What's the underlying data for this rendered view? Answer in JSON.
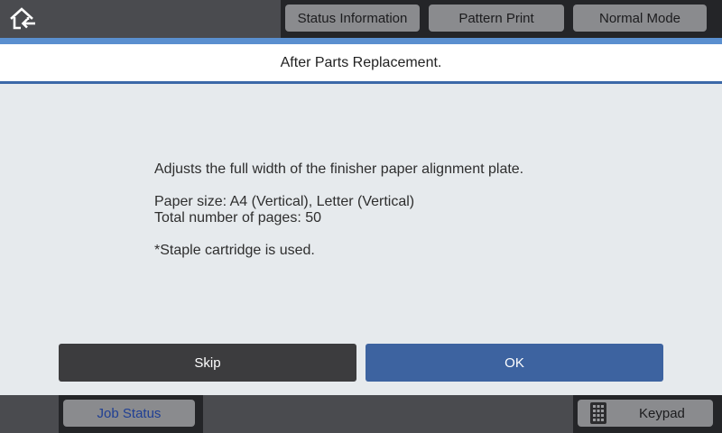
{
  "header": {
    "home_icon": "home-back-icon",
    "buttons": {
      "status_information": "Status Information",
      "pattern_print": "Pattern Print",
      "normal_mode": "Normal Mode"
    }
  },
  "title": "After Parts Replacement.",
  "message": {
    "line1": "Adjusts the full width of the finisher paper alignment plate.",
    "line2": "Paper size: A4 (Vertical), Letter (Vertical)",
    "line3": "Total number of pages: 50",
    "line4": "*Staple cartridge is used."
  },
  "actions": {
    "skip": "Skip",
    "ok": "OK"
  },
  "footer": {
    "job_status": "Job Status",
    "keypad": "Keypad",
    "keypad_icon": "keypad-icon"
  },
  "colors": {
    "accent": "#5a8fcf",
    "ok_button": "#3d63a0",
    "skip_button": "#3c3c3e",
    "job_status_text": "#1f3f94"
  }
}
